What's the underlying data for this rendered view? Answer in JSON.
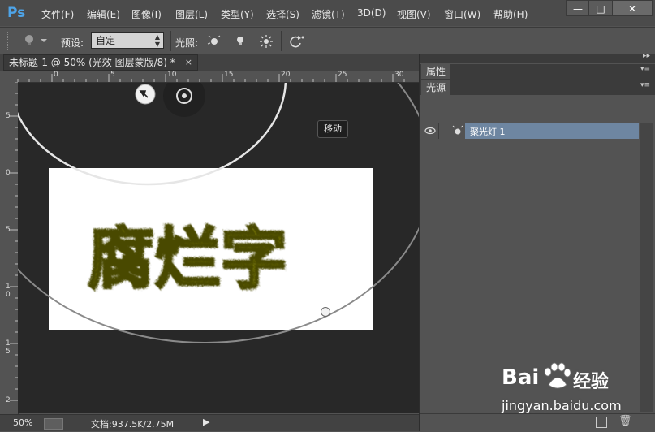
{
  "app": {
    "logo": "Ps",
    "accent": "#4ea4e8"
  },
  "menu": [
    "文件(F)",
    "编辑(E)",
    "图像(I)",
    "图层(L)",
    "类型(Y)",
    "选择(S)",
    "滤镜(T)",
    "3D(D)",
    "视图(V)",
    "窗口(W)",
    "帮助(H)"
  ],
  "window": {
    "min": "—",
    "max": "□",
    "close": "✕"
  },
  "options": {
    "preset_label": "预设:",
    "preset_value": "自定",
    "light_label": "光照:"
  },
  "document": {
    "tab_title": "未标题-1 @ 50% (光效 图层蒙版/8) *",
    "close": "×",
    "text": "腐烂字",
    "text_color": "#7a7a10"
  },
  "ruler_top": [
    "0",
    "5",
    "10",
    "15",
    "20",
    "25",
    "30"
  ],
  "ruler_left": [
    "5",
    "0",
    "5",
    "1\n0",
    "1\n5",
    "2"
  ],
  "tooltip": "移动",
  "status": {
    "zoom": "50%",
    "doc_info": "文档:937.5K/2.75M"
  },
  "panels": {
    "properties_tab": "属性",
    "lights_tab": "光源",
    "lights": [
      {
        "name": "聚光灯 1",
        "selected": true
      }
    ],
    "selected_color": "#6e86a1"
  },
  "watermark": {
    "brand": "Bai",
    "brand2": "经验",
    "url": "jingyan.baidu.com"
  }
}
